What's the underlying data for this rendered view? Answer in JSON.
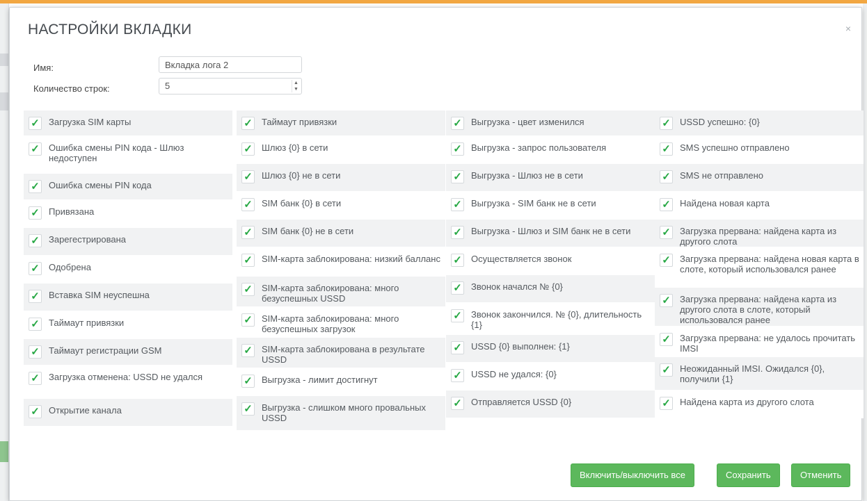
{
  "dialog": {
    "title": "НАСТРОЙКИ ВКЛАДКИ",
    "close_icon": "×"
  },
  "form": {
    "name_label": "Имя:",
    "name_value": "Вкладка лога 2",
    "rows_label": "Количество строк:",
    "rows_value": "5"
  },
  "columns": [
    {
      "items": [
        {
          "label": "Загрузка SIM карты",
          "checked": true
        },
        {
          "label": "Ошибка смены PIN кода - Шлюз недоступен",
          "checked": true
        },
        {
          "label": "Ошибка смены PIN кода",
          "checked": true
        },
        {
          "label": "Привязана",
          "checked": true
        },
        {
          "label": "Зарегестрирована",
          "checked": true
        },
        {
          "label": "Одобрена",
          "checked": true
        },
        {
          "label": "Вставка SIM неуспешна",
          "checked": true
        },
        {
          "label": "Таймаут привязки",
          "checked": true
        },
        {
          "label": "Таймаут регистрации GSM",
          "checked": true
        },
        {
          "label": "Загрузка отменена: USSD не удался",
          "checked": true
        },
        {
          "label": "Открытие канала",
          "checked": true
        }
      ]
    },
    {
      "items": [
        {
          "label": "Таймаут привязки",
          "checked": true
        },
        {
          "label": "Шлюз {0} в сети",
          "checked": true
        },
        {
          "label": "Шлюз {0} не в сети",
          "checked": true
        },
        {
          "label": "SIM банк {0} в сети",
          "checked": true
        },
        {
          "label": "SIM банк {0} не в сети",
          "checked": true
        },
        {
          "label": "SIM-карта заблокирована: низкий балланс",
          "checked": true
        },
        {
          "label": "SIM-карта заблокирована: много безуспешных USSD",
          "checked": true
        },
        {
          "label": "SIM-карта заблокирована: много безуспешных загрузок",
          "checked": true
        },
        {
          "label": "SIM-карта заблокирована в результате USSD",
          "checked": true
        },
        {
          "label": "Выгрузка - лимит достигнут",
          "checked": true
        },
        {
          "label": "Выгрузка - слишком много провальных USSD",
          "checked": true
        }
      ]
    },
    {
      "items": [
        {
          "label": "Выгрузка - цвет изменился",
          "checked": true
        },
        {
          "label": "Выгрузка - запрос пользователя",
          "checked": true
        },
        {
          "label": "Выгрузка - Шлюз не в сети",
          "checked": true
        },
        {
          "label": "Выгрузка - SIM банк не в сети",
          "checked": true
        },
        {
          "label": "Выгрузка - Шлюз и SIM банк не в сети",
          "checked": true
        },
        {
          "label": "Осуществляется звонок",
          "checked": true
        },
        {
          "label": "Звонок начался № {0}",
          "checked": true
        },
        {
          "label": "Звонок закончился. № {0}, длительность {1}",
          "checked": true
        },
        {
          "label": "USSD {0} выполнен: {1}",
          "checked": true
        },
        {
          "label": "USSD не удался: {0}",
          "checked": true
        },
        {
          "label": "Отправляется USSD {0}",
          "checked": true
        }
      ]
    },
    {
      "items": [
        {
          "label": "USSD успешно: {0}",
          "checked": true
        },
        {
          "label": "SMS успешно отправлено",
          "checked": true
        },
        {
          "label": "SMS не отправлено",
          "checked": true
        },
        {
          "label": "Найдена новая карта",
          "checked": true
        },
        {
          "label": "Загрузка прервана: найдена карта из другого слота",
          "checked": true
        },
        {
          "label": "Загрузка прервана: найдена новая карта в слоте, который использовался ранее",
          "checked": true
        },
        {
          "label": "Загрузка прервана: найдена карта из другого слота в слоте, который использовался ранее",
          "checked": true
        },
        {
          "label": "Загрузка прервана: не удалось прочитать IMSI",
          "checked": true
        },
        {
          "label": "Неожиданный IMSI. Ожидался {0}, получили {1}",
          "checked": true
        },
        {
          "label": "Найдена карта из другого слота",
          "checked": true
        }
      ]
    }
  ],
  "check_glyph": "✓",
  "buttons": {
    "toggle_all": "Включить/выключить все",
    "save": "Сохранить",
    "cancel": "Отменить"
  },
  "colors": {
    "accent_top": "#f2a742",
    "check_green": "#27a844",
    "button_green": "#5cb85c"
  }
}
